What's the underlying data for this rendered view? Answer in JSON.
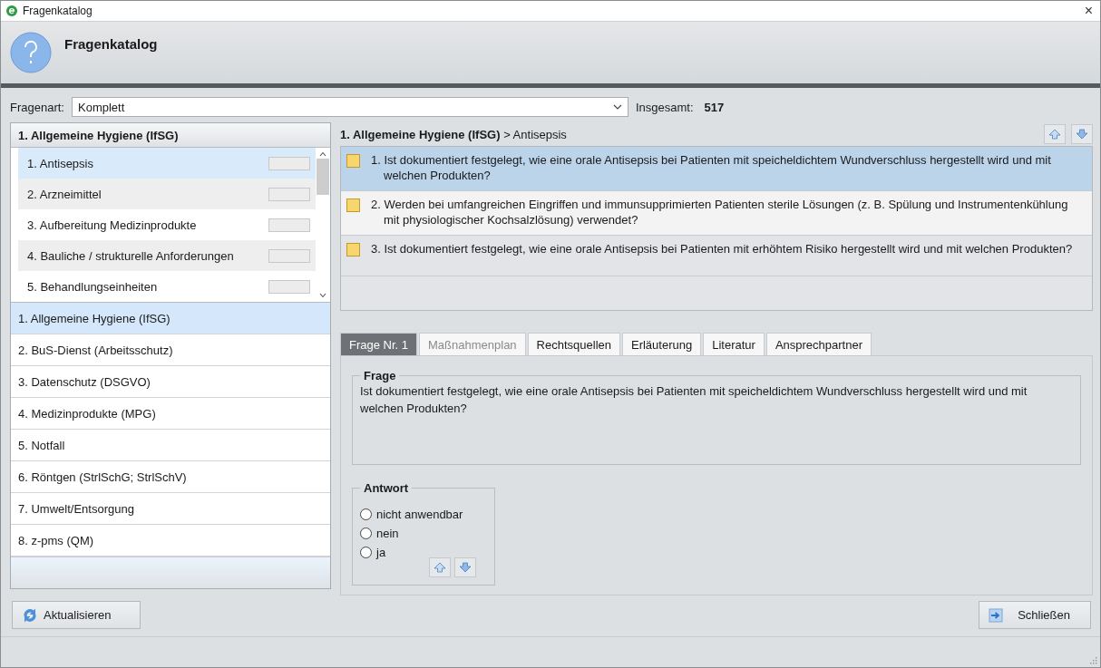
{
  "window": {
    "title": "Fragenkatalog",
    "close": "×"
  },
  "header": {
    "title": "Fragenkatalog"
  },
  "filter": {
    "label": "Fragenart:",
    "value": "Komplett",
    "total_label": "Insgesamt:",
    "total": "517"
  },
  "subcategories": {
    "title": "1. Allgemeine Hygiene (IfSG)",
    "items": [
      {
        "label": "1. Antisepsis",
        "selected": true
      },
      {
        "label": "2. Arzneimittel",
        "selected": false
      },
      {
        "label": "3. Aufbereitung Medizinprodukte",
        "selected": false
      },
      {
        "label": "4. Bauliche / strukturelle Anforderungen",
        "selected": false
      },
      {
        "label": "5. Behandlungseinheiten",
        "selected": false
      }
    ]
  },
  "categories": [
    {
      "label": "1. Allgemeine Hygiene (IfSG)",
      "selected": true
    },
    {
      "label": "2. BuS-Dienst (Arbeitsschutz)",
      "selected": false
    },
    {
      "label": "3. Datenschutz (DSGVO)",
      "selected": false
    },
    {
      "label": "4. Medizinprodukte (MPG)",
      "selected": false
    },
    {
      "label": "5. Notfall",
      "selected": false
    },
    {
      "label": "6. Röntgen (StrlSchG; StrlSchV)",
      "selected": false
    },
    {
      "label": "7. Umwelt/Entsorgung",
      "selected": false
    },
    {
      "label": "8. z-pms (QM)",
      "selected": false
    }
  ],
  "questions": {
    "breadcrumb": "**1. Allgemeine Hygiene (IfSG)** > Antisepsis",
    "items": [
      {
        "text": "1. Ist dokumentiert festgelegt, wie eine orale Antisepsis bei Patienten mit speicheldichtem Wundverschluss hergestellt wird und mit welchen Produkten?",
        "selected": true
      },
      {
        "text": "2. Werden bei umfangreichen Eingriffen und immunsupprimierten Patienten sterile Lösungen (z. B. Spülung und Instrumentenkühlung mit physiologischer Kochsalzlösung) verwendet?",
        "selected": false
      },
      {
        "text": "3. Ist dokumentiert festgelegt, wie eine orale Antisepsis bei Patienten mit erhöhtem Risiko hergestellt wird und mit welchen Produkten?",
        "selected": false
      }
    ]
  },
  "tabs": [
    {
      "label": "Frage Nr. 1",
      "selected": true,
      "disabled": false
    },
    {
      "label": "Maßnahmenplan",
      "selected": false,
      "disabled": true
    },
    {
      "label": "Rechtsquellen",
      "selected": false,
      "disabled": false
    },
    {
      "label": "Erläuterung",
      "selected": false,
      "disabled": false
    },
    {
      "label": "Literatur",
      "selected": false,
      "disabled": false
    },
    {
      "label": "Ansprechpartner",
      "selected": false,
      "disabled": false
    }
  ],
  "question_box": {
    "title": "Frage",
    "text": "Ist dokumentiert festgelegt, wie eine orale Antisepsis bei Patienten mit speicheldichtem Wundverschluss hergestellt wird und mit welchen Produkten?"
  },
  "answer": {
    "title": "Antwort",
    "options": [
      {
        "label": "nicht anwendbar",
        "selected": false
      },
      {
        "label": "nein",
        "selected": false
      },
      {
        "label": "ja",
        "selected": false
      }
    ]
  },
  "buttons": {
    "refresh": "Aktualisieren",
    "close": "Schließen"
  }
}
